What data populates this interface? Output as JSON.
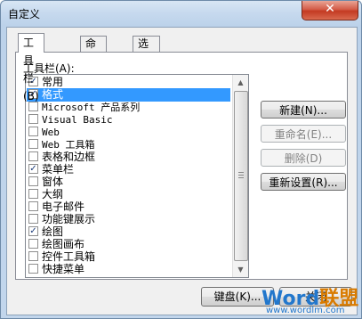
{
  "window": {
    "title": "自定义",
    "close_glyph": "✕"
  },
  "tabs": [
    {
      "label": "工具栏(B)",
      "active": true
    },
    {
      "label": "命令(C)",
      "active": false
    },
    {
      "label": "选项(O)",
      "active": false
    }
  ],
  "toolbars_label": "工具栏(A):",
  "toolbars": [
    {
      "label": "常用",
      "checked": true,
      "selected": false,
      "mono": false
    },
    {
      "label": "格式",
      "checked": true,
      "selected": true,
      "mono": false
    },
    {
      "label": "Microsoft 产品系列",
      "checked": false,
      "selected": false,
      "mono": true
    },
    {
      "label": "Visual Basic",
      "checked": false,
      "selected": false,
      "mono": true
    },
    {
      "label": "Web",
      "checked": false,
      "selected": false,
      "mono": true
    },
    {
      "label": "Web 工具箱",
      "checked": false,
      "selected": false,
      "mono": true
    },
    {
      "label": "表格和边框",
      "checked": false,
      "selected": false,
      "mono": false
    },
    {
      "label": "菜单栏",
      "checked": true,
      "selected": false,
      "mono": false
    },
    {
      "label": "窗体",
      "checked": false,
      "selected": false,
      "mono": false
    },
    {
      "label": "大纲",
      "checked": false,
      "selected": false,
      "mono": false
    },
    {
      "label": "电子邮件",
      "checked": false,
      "selected": false,
      "mono": false
    },
    {
      "label": "功能键展示",
      "checked": false,
      "selected": false,
      "mono": false
    },
    {
      "label": "绘图",
      "checked": true,
      "selected": false,
      "mono": false
    },
    {
      "label": "绘图画布",
      "checked": false,
      "selected": false,
      "mono": false
    },
    {
      "label": "控件工具箱",
      "checked": false,
      "selected": false,
      "mono": false
    },
    {
      "label": "快捷菜单",
      "checked": false,
      "selected": false,
      "mono": false
    }
  ],
  "buttons": {
    "new": "新建(N)...",
    "rename": "重命名(E)...",
    "delete": "删除(D)",
    "reset": "重新设置(R)...",
    "keyboard": "键盘(K)...",
    "close": "关闭"
  },
  "watermark": {
    "brand_latin": "Word",
    "brand_cn": "联盟",
    "url": "www.wordlm.com"
  }
}
